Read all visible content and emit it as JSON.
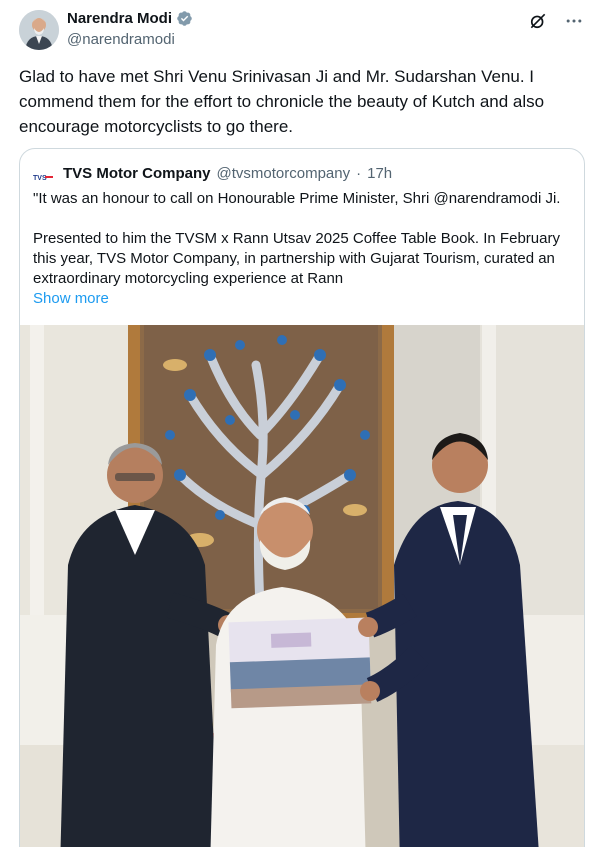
{
  "author": {
    "name": "Narendra Modi",
    "handle": "@narendramodi",
    "verified": true,
    "verified_color": "#829aab"
  },
  "tweet": {
    "text": "Glad to have met Shri Venu Srinivasan Ji and Mr. Sudarshan Venu. I commend them for the effort to chronicle the beauty of Kutch and also encourage motorcyclists to go there."
  },
  "actions": {
    "grok_icon": "grok-icon",
    "more_icon": "more-icon"
  },
  "quote": {
    "logo_text": "TVS",
    "name": "TVS Motor Company",
    "handle": "@tvsmotorcompany",
    "separator": "·",
    "time": "17h",
    "paragraph1": "\"It was an honour to call on Honourable Prime Minister, Shri @narendramodi Ji.",
    "paragraph2": "Presented to him the TVSM x Rann Utsav 2025 Coffee Table Book. In February this year, TVS Motor Company, in partnership with Gujarat Tourism, curated an extraordinary motorcycling experience at Rann",
    "show_more": "Show more",
    "image_icon": "photo-image"
  },
  "colors": {
    "text": "#0f1419",
    "secondary": "#536471",
    "link": "#1d9bf0",
    "border": "#cfd9de"
  }
}
